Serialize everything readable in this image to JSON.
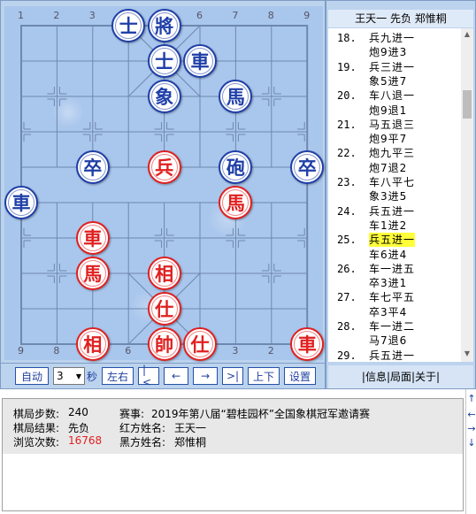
{
  "board": {
    "files_top": [
      "1",
      "2",
      "3",
      "4",
      "5",
      "6",
      "7",
      "8",
      "9"
    ],
    "files_bottom": [
      "9",
      "8",
      "7",
      "6",
      "5",
      "4",
      "3",
      "2",
      "1"
    ],
    "pieces": [
      {
        "id": "b-advisor-1",
        "char": "士",
        "side": "black",
        "file": 3,
        "rank": 0
      },
      {
        "id": "b-general",
        "char": "將",
        "side": "black",
        "file": 4,
        "rank": 0
      },
      {
        "id": "b-advisor-2",
        "char": "士",
        "side": "black",
        "file": 4,
        "rank": 1
      },
      {
        "id": "b-chariot-1",
        "char": "車",
        "side": "black",
        "file": 5,
        "rank": 1
      },
      {
        "id": "b-elephant",
        "char": "象",
        "side": "black",
        "file": 4,
        "rank": 2
      },
      {
        "id": "b-horse",
        "char": "馬",
        "side": "black",
        "file": 6,
        "rank": 2
      },
      {
        "id": "b-soldier-1",
        "char": "卒",
        "side": "black",
        "file": 2,
        "rank": 4
      },
      {
        "id": "r-pawn",
        "char": "兵",
        "side": "red",
        "file": 4,
        "rank": 4
      },
      {
        "id": "b-cannon",
        "char": "砲",
        "side": "black",
        "file": 6,
        "rank": 4
      },
      {
        "id": "b-soldier-2",
        "char": "卒",
        "side": "black",
        "file": 8,
        "rank": 4
      },
      {
        "id": "b-chariot-2",
        "char": "車",
        "side": "black",
        "file": 0,
        "rank": 5
      },
      {
        "id": "r-horse-1",
        "char": "馬",
        "side": "red",
        "file": 6,
        "rank": 5
      },
      {
        "id": "r-chariot-1",
        "char": "車",
        "side": "red",
        "file": 2,
        "rank": 6
      },
      {
        "id": "r-horse-2",
        "char": "馬",
        "side": "red",
        "file": 2,
        "rank": 7
      },
      {
        "id": "r-minister-1",
        "char": "相",
        "side": "red",
        "file": 4,
        "rank": 7
      },
      {
        "id": "r-advisor-1",
        "char": "仕",
        "side": "red",
        "file": 4,
        "rank": 8
      },
      {
        "id": "r-minister-2",
        "char": "相",
        "side": "red",
        "file": 2,
        "rank": 9
      },
      {
        "id": "r-king",
        "char": "帥",
        "side": "red",
        "file": 4,
        "rank": 9
      },
      {
        "id": "r-advisor-2",
        "char": "仕",
        "side": "red",
        "file": 5,
        "rank": 9
      },
      {
        "id": "r-chariot-2",
        "char": "車",
        "side": "red",
        "file": 8,
        "rank": 9
      }
    ]
  },
  "controls": {
    "auto": "自动",
    "interval_value": "3",
    "interval_unit": "秒",
    "left_right": "左右",
    "first": "|<",
    "prev": "←",
    "next": "→",
    "last": ">|",
    "up_down": "上下",
    "settings": "设置"
  },
  "movelist": {
    "header": "王天一 先负 郑惟桐",
    "active_index": 14,
    "moves": [
      {
        "num": "18.",
        "text": "兵九进一"
      },
      {
        "num": "",
        "text": "炮9进3"
      },
      {
        "num": "19.",
        "text": "兵三进一"
      },
      {
        "num": "",
        "text": "象5进7"
      },
      {
        "num": "20.",
        "text": "车八退一"
      },
      {
        "num": "",
        "text": "炮9退1"
      },
      {
        "num": "21.",
        "text": "马五退三"
      },
      {
        "num": "",
        "text": "炮9平7"
      },
      {
        "num": "22.",
        "text": "炮九平三"
      },
      {
        "num": "",
        "text": "炮7退2"
      },
      {
        "num": "23.",
        "text": "车八平七"
      },
      {
        "num": "",
        "text": "象3进5"
      },
      {
        "num": "24.",
        "text": "兵五进一"
      },
      {
        "num": "",
        "text": "车1进2"
      },
      {
        "num": "25.",
        "text": "兵五进一"
      },
      {
        "num": "",
        "text": "车6进4"
      },
      {
        "num": "26.",
        "text": "车一进五"
      },
      {
        "num": "",
        "text": "卒3进1"
      },
      {
        "num": "27.",
        "text": "车七平五"
      },
      {
        "num": "",
        "text": "卒3平4"
      },
      {
        "num": "28.",
        "text": "车一进二"
      },
      {
        "num": "",
        "text": "马7退6"
      },
      {
        "num": "29.",
        "text": "兵五进一"
      }
    ],
    "footer": "|信息|局面|关于|"
  },
  "info": {
    "steps_label": "棋局步数:",
    "steps_value": "240",
    "result_label": "棋局结果:",
    "result_value": "先负",
    "views_label": "浏览次数:",
    "views_value": "16768",
    "event_label": "赛事:",
    "event_value": "2019年第八届“碧桂园杯”全国象棋冠军邀请赛",
    "red_label": "红方姓名:",
    "red_value": "王天一",
    "black_label": "黑方姓名:",
    "black_value": "郑惟桐"
  },
  "side_scroll": {
    "up": "↑",
    "left": "←",
    "right": "→",
    "down": "↓"
  }
}
